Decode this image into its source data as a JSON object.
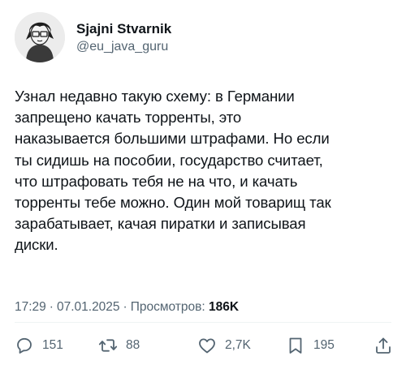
{
  "author": {
    "name": "Sjajni Stvarnik",
    "handle": "@eu_java_guru"
  },
  "tweet": {
    "text": "Узнал недавно такую схему: в Германии\nзапрещено качать торренты, это\nнаказывается большими штрафами. Но если\nты сидишь на пособии, государство считает,\nчто штрафовать тебя не на что, и качать\nторренты тебе можно. Один мой товарищ так\nзарабатывает, качая пиратки и записывая\nдиски."
  },
  "meta": {
    "time": "17:29",
    "separator": "·",
    "date": "07.01.2025",
    "views_label": "Просмотров:",
    "views_count": "186K"
  },
  "actions": {
    "replies": "151",
    "retweets": "88",
    "likes": "2,7K",
    "bookmarks": "195"
  },
  "colors": {
    "text": "#0f1419",
    "secondary": "#536471",
    "divider": "#eff3f4"
  },
  "icons": [
    "reply-icon",
    "retweet-icon",
    "like-icon",
    "bookmark-icon",
    "share-icon"
  ]
}
